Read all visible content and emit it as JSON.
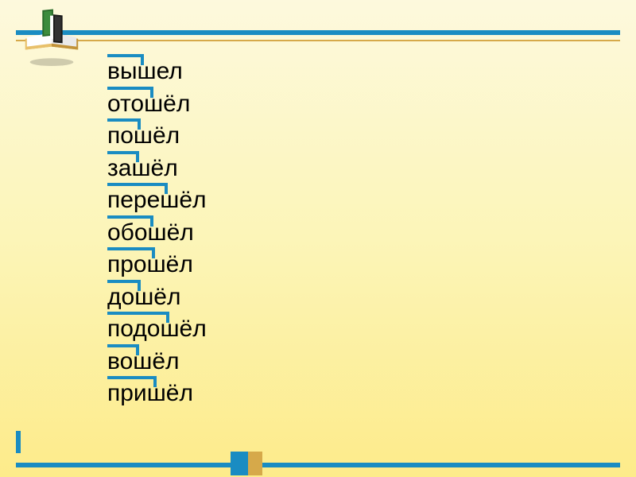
{
  "words": [
    {
      "text": "вышел",
      "prefix_left": 0,
      "prefix_width": 46
    },
    {
      "text": "отошёл",
      "prefix_left": 0,
      "prefix_width": 58
    },
    {
      "text": "пошёл",
      "prefix_left": 0,
      "prefix_width": 42
    },
    {
      "text": "зашёл",
      "prefix_left": 0,
      "prefix_width": 40
    },
    {
      "text": "перешёл",
      "prefix_left": 0,
      "prefix_width": 76
    },
    {
      "text": "обошёл",
      "prefix_left": 0,
      "prefix_width": 58
    },
    {
      "text": "прошёл",
      "prefix_left": 0,
      "prefix_width": 60
    },
    {
      "text": "дошёл",
      "prefix_left": 0,
      "prefix_width": 42
    },
    {
      "text": "подошёл",
      "prefix_left": 0,
      "prefix_width": 78
    },
    {
      "text": "вошёл",
      "prefix_left": 0,
      "prefix_width": 40
    },
    {
      "text": "пришёл",
      "prefix_left": 0,
      "prefix_width": 62
    }
  ],
  "colors": {
    "accent_blue": "#1a8cc2",
    "accent_gold": "#d6a94a"
  }
}
